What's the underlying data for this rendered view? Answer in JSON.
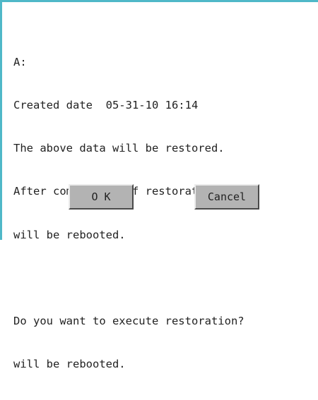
{
  "dialog": {
    "lines": [
      "A:",
      "Created date  05-31-10 16:14",
      "The above data will be restored.",
      "After completion of restoration, GOT",
      "will be rebooted.",
      "",
      "Do you want to execute restoration?",
      "will be rebooted."
    ],
    "ok_label": "O K",
    "cancel_label": "Cancel"
  },
  "colors": {
    "frame_accent": "#4fb8c8",
    "button_face": "#b3b3b3"
  }
}
